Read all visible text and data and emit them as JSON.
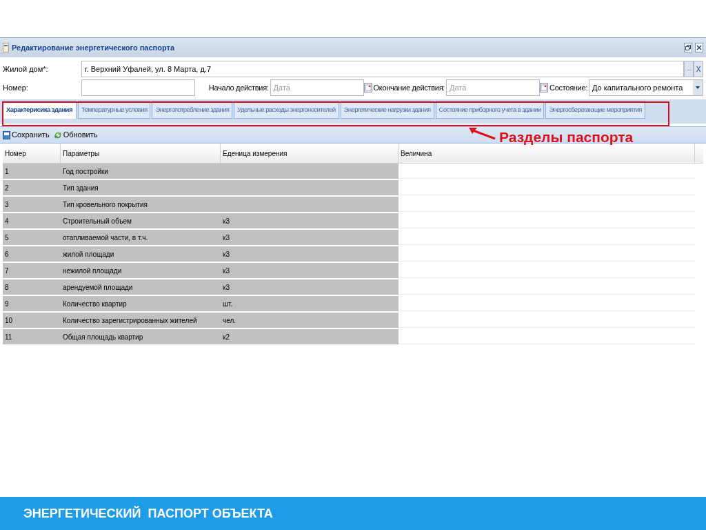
{
  "window": {
    "title": "Редактирование энергетического паспорта"
  },
  "form": {
    "house": {
      "label": "Жилой дом*:",
      "value": "г. Верхний Уфалей, ул. 8 Марта, д.7",
      "browse": "...",
      "clear": "X"
    },
    "number": {
      "label": "Номер:"
    },
    "start": {
      "label": "Начало действия:",
      "placeholder": "Дата"
    },
    "end": {
      "label": "Окончание действия:",
      "placeholder": "Дата"
    },
    "state": {
      "label": "Состояние:",
      "value": "До капитального ремонта"
    }
  },
  "tabs": [
    {
      "label": "Характерисика здания",
      "selected": true
    },
    {
      "label": "Температурные условия",
      "selected": false
    },
    {
      "label": "Энергопотребление здания",
      "selected": false
    },
    {
      "label": "Удельные расходы энергоносителей",
      "selected": false
    },
    {
      "label": "Энергетические нагрузки здания",
      "selected": false
    },
    {
      "label": "Состояние приборного учета в здании",
      "selected": false
    },
    {
      "label": "Энергосберегающие мероприятия",
      "selected": false
    }
  ],
  "toolbar": [
    "Сохранить",
    "Обновить"
  ],
  "table": {
    "columns": [
      "Номер",
      "Параметры",
      "Еденица измерения",
      "Величина"
    ],
    "rows": [
      [
        "1",
        "Год постройки",
        ""
      ],
      [
        "2",
        "Тип здания",
        ""
      ],
      [
        "3",
        "Тип кровельного покрытия",
        ""
      ],
      [
        "4",
        "Строительный объем",
        "к3"
      ],
      [
        "5",
        "отапливаемой части, в т.ч.",
        "к3"
      ],
      [
        "6",
        "жилой площади",
        "к3"
      ],
      [
        "7",
        "нежилой площади",
        "к3"
      ],
      [
        "8",
        "арендуемой площади",
        "к3"
      ],
      [
        "9",
        "Количество квартир",
        "шт."
      ],
      [
        "10",
        "Количество зарегистрированных жителей",
        "чел."
      ],
      [
        "11",
        "Общая площадь квартир",
        "к2"
      ]
    ]
  },
  "annotation": {
    "label": "Разделы паспорта"
  },
  "footer": {
    "title": "ЭНЕРГЕТИЧЕСКИЙ  ПАСПОРТ ОБЪЕКТА"
  }
}
